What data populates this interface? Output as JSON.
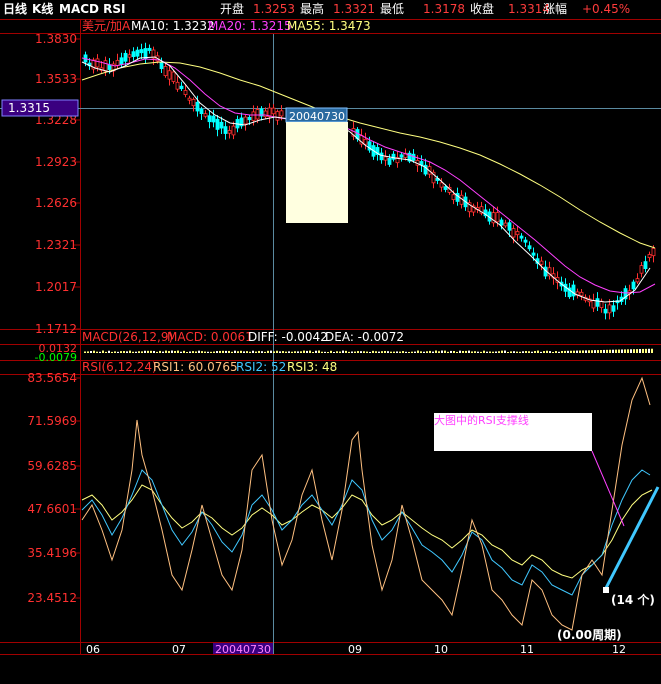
{
  "header": {
    "period": "日线",
    "chart_kind": "K线",
    "indicators": "MACD RSI",
    "open_label": "开盘",
    "open_value": "1.3253",
    "high_label": "最高",
    "high_value": "1.3321",
    "low_label": "最低",
    "low_value": "1.3178",
    "close_label": "收盘",
    "close_value": "1.3314",
    "change_label": "涨幅",
    "change_value": "+0.45%"
  },
  "price_panel": {
    "symbol": "美元/加A",
    "ma10_label": "MA10: 1.3232",
    "ma20_label": "MA20: 1.3215",
    "ma55_label": "MA55: 1.3473",
    "y_ticks": [
      "1.3830",
      "1.3533",
      "1.3228",
      "1.2923",
      "1.2626",
      "1.2321",
      "1.2017",
      "1.1712"
    ],
    "current_price_tag": "1.3315",
    "cursor_date": "20040730",
    "colors": {
      "ma10": "#ffffff",
      "ma20": "#ff40ff",
      "ma55": "#ffff80",
      "up": "#ff3030",
      "down": "#00ffff"
    }
  },
  "macd_panel": {
    "title": "MACD(26,12,9)",
    "macd_label": "MACD: 0.0061",
    "diff_label": "DIFF: -0.0042",
    "dea_label": "DEA: -0.0072",
    "y_ticks": [
      "0.0132",
      "-0.0079"
    ]
  },
  "rsi_panel": {
    "title": "RSI(6,12,24)",
    "rsi1_label": "RSI1: 60.0765",
    "rsi2_label": "RSI2: 52",
    "rsi3_label": "RSI3: 48",
    "y_ticks": [
      "83.5654",
      "71.5969",
      "59.6285",
      "47.6601",
      "35.4196",
      "23.4512"
    ],
    "annotation": "大图中的RSI支撑线",
    "period_count": "(14 个)",
    "colors": {
      "rsi1": "#ffc080",
      "rsi2": "#40c8ff",
      "rsi3": "#ffff80",
      "support": "#40c8ff"
    }
  },
  "x_axis": {
    "ticks": [
      "06",
      "07",
      "08",
      "09",
      "10",
      "11",
      "12"
    ],
    "cursor_date": "20040730",
    "period_label": "(0.00周期)"
  }
}
